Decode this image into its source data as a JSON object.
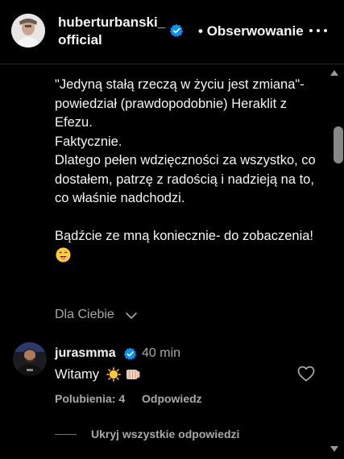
{
  "post": {
    "author": {
      "username": "huberturbanski_\nofficial",
      "verified": true,
      "follow_status": "Obserwowanie"
    },
    "caption_lines": [
      "\"Jedyną stałą rzeczą w życiu jest zmiana\"- powiedział (prawdopodobnie) Heraklit z Efezu.",
      "Faktycznie.",
      "Dlatego pełen wdzięczności za wszystko, co dostałem, patrzę z radością i nadzieją na to, co właśnie nadchodzi.",
      "Bądźcie ze mną koniecznie- do zobaczenia!"
    ],
    "caption_emoji": "grinning-face-with-tongue",
    "for_you_label": "Dla Ciebie"
  },
  "comment": {
    "username": "jurasmma",
    "verified": true,
    "time": "40 min",
    "text": "Witamy",
    "emojis": [
      "sun-emoji",
      "fist-bump-emoji"
    ],
    "likes_label": "Polubienia: 4",
    "reply_label": "Odpowiedz",
    "hide_replies_label": "Ukryj wszystkie odpowiedzi"
  },
  "colors": {
    "background": "#000000",
    "text": "#f5f5f5",
    "muted": "#a8a8a8",
    "verified": "#0095f6"
  }
}
